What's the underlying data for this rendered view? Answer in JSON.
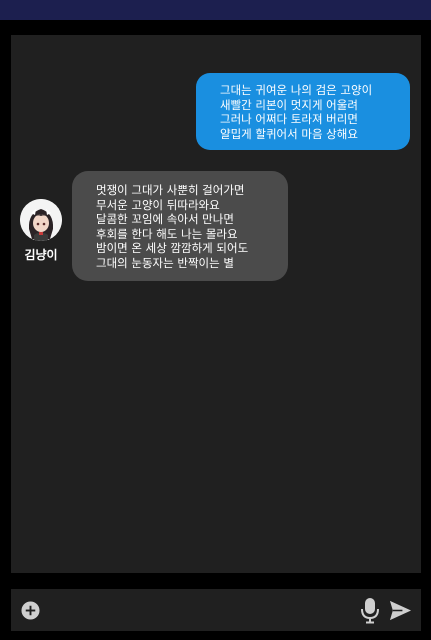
{
  "conversation": {
    "messages": [
      {
        "direction": "sent",
        "text": "그대는 귀여운 나의 검은 고양이\n새빨간 리본이 멋지게 어울려\n그러나 어쩌다 토라져 버리면\n얄밉게 할퀴어서 마음 상해요"
      },
      {
        "direction": "received",
        "sender": "김냥이",
        "avatar": "avatar-anime-girl",
        "text": "멋쟁이 그대가 사뿐히 걸어가면\n무서운 고양이 뒤따라와요\n달콤한 꼬임에 속아서 만나면\n후회를 한다 해도 나는 몰라요\n밤이면 온 세상 깜깜하게 되어도\n그대의 눈동자는 반짝이는 별"
      }
    ]
  },
  "input_bar": {
    "icons": [
      "plus-circle-icon",
      "microphone-icon",
      "send-icon"
    ]
  },
  "colors": {
    "top_bar": "#1c1f4f",
    "panel": "#202020",
    "sent_bubble": "#1a8fe0",
    "received_bubble": "#4b4b4b",
    "icon": "#cfcfcf"
  }
}
